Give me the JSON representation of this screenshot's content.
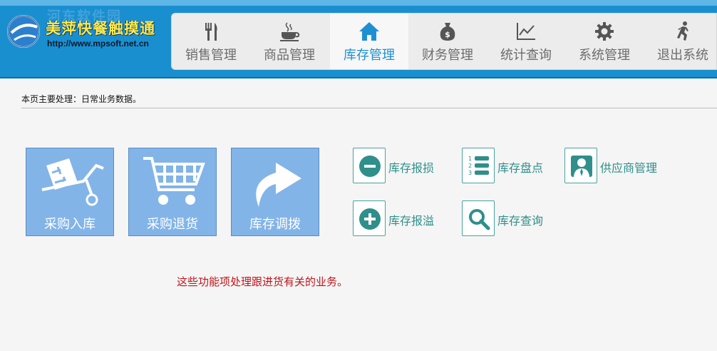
{
  "header": {
    "app_title": "美萍快餐触摸通",
    "url": "http://www.mpsoft.net.cn",
    "watermark": "河东软件园"
  },
  "nav": {
    "items": [
      {
        "label": "销售管理",
        "icon": "fork-knife-icon"
      },
      {
        "label": "商品管理",
        "icon": "coffee-cup-icon"
      },
      {
        "label": "库存管理",
        "icon": "home-icon",
        "active": true
      },
      {
        "label": "财务管理",
        "icon": "money-bag-icon"
      },
      {
        "label": "统计查询",
        "icon": "line-chart-icon"
      },
      {
        "label": "系统管理",
        "icon": "gear-icon"
      },
      {
        "label": "退出系统",
        "icon": "running-man-icon"
      }
    ]
  },
  "page": {
    "notice": "本页主要处理：日常业务数据。",
    "footnote": "这些功能项处理跟进货有关的业务。"
  },
  "tiles": [
    {
      "label": "采购入库",
      "icon": "hand-truck-icon"
    },
    {
      "label": "采购退货",
      "icon": "shopping-cart-icon"
    },
    {
      "label": "库存调拨",
      "icon": "curved-arrow-icon"
    }
  ],
  "actions": [
    {
      "label": "库存报损",
      "icon": "minus-circle-icon"
    },
    {
      "label": "库存盘点",
      "icon": "numbered-list-icon"
    },
    {
      "label": "供应商管理",
      "icon": "person-icon"
    },
    {
      "label": "库存报溢",
      "icon": "plus-circle-icon"
    },
    {
      "label": "库存查询",
      "icon": "magnifier-icon"
    }
  ],
  "colors": {
    "header_blue": "#1a8fd0",
    "active_nav": "#1e90d2",
    "tile_blue": "#82b4e8",
    "action_teal": "#2f8f8a",
    "footnote_red": "#c0141b"
  }
}
